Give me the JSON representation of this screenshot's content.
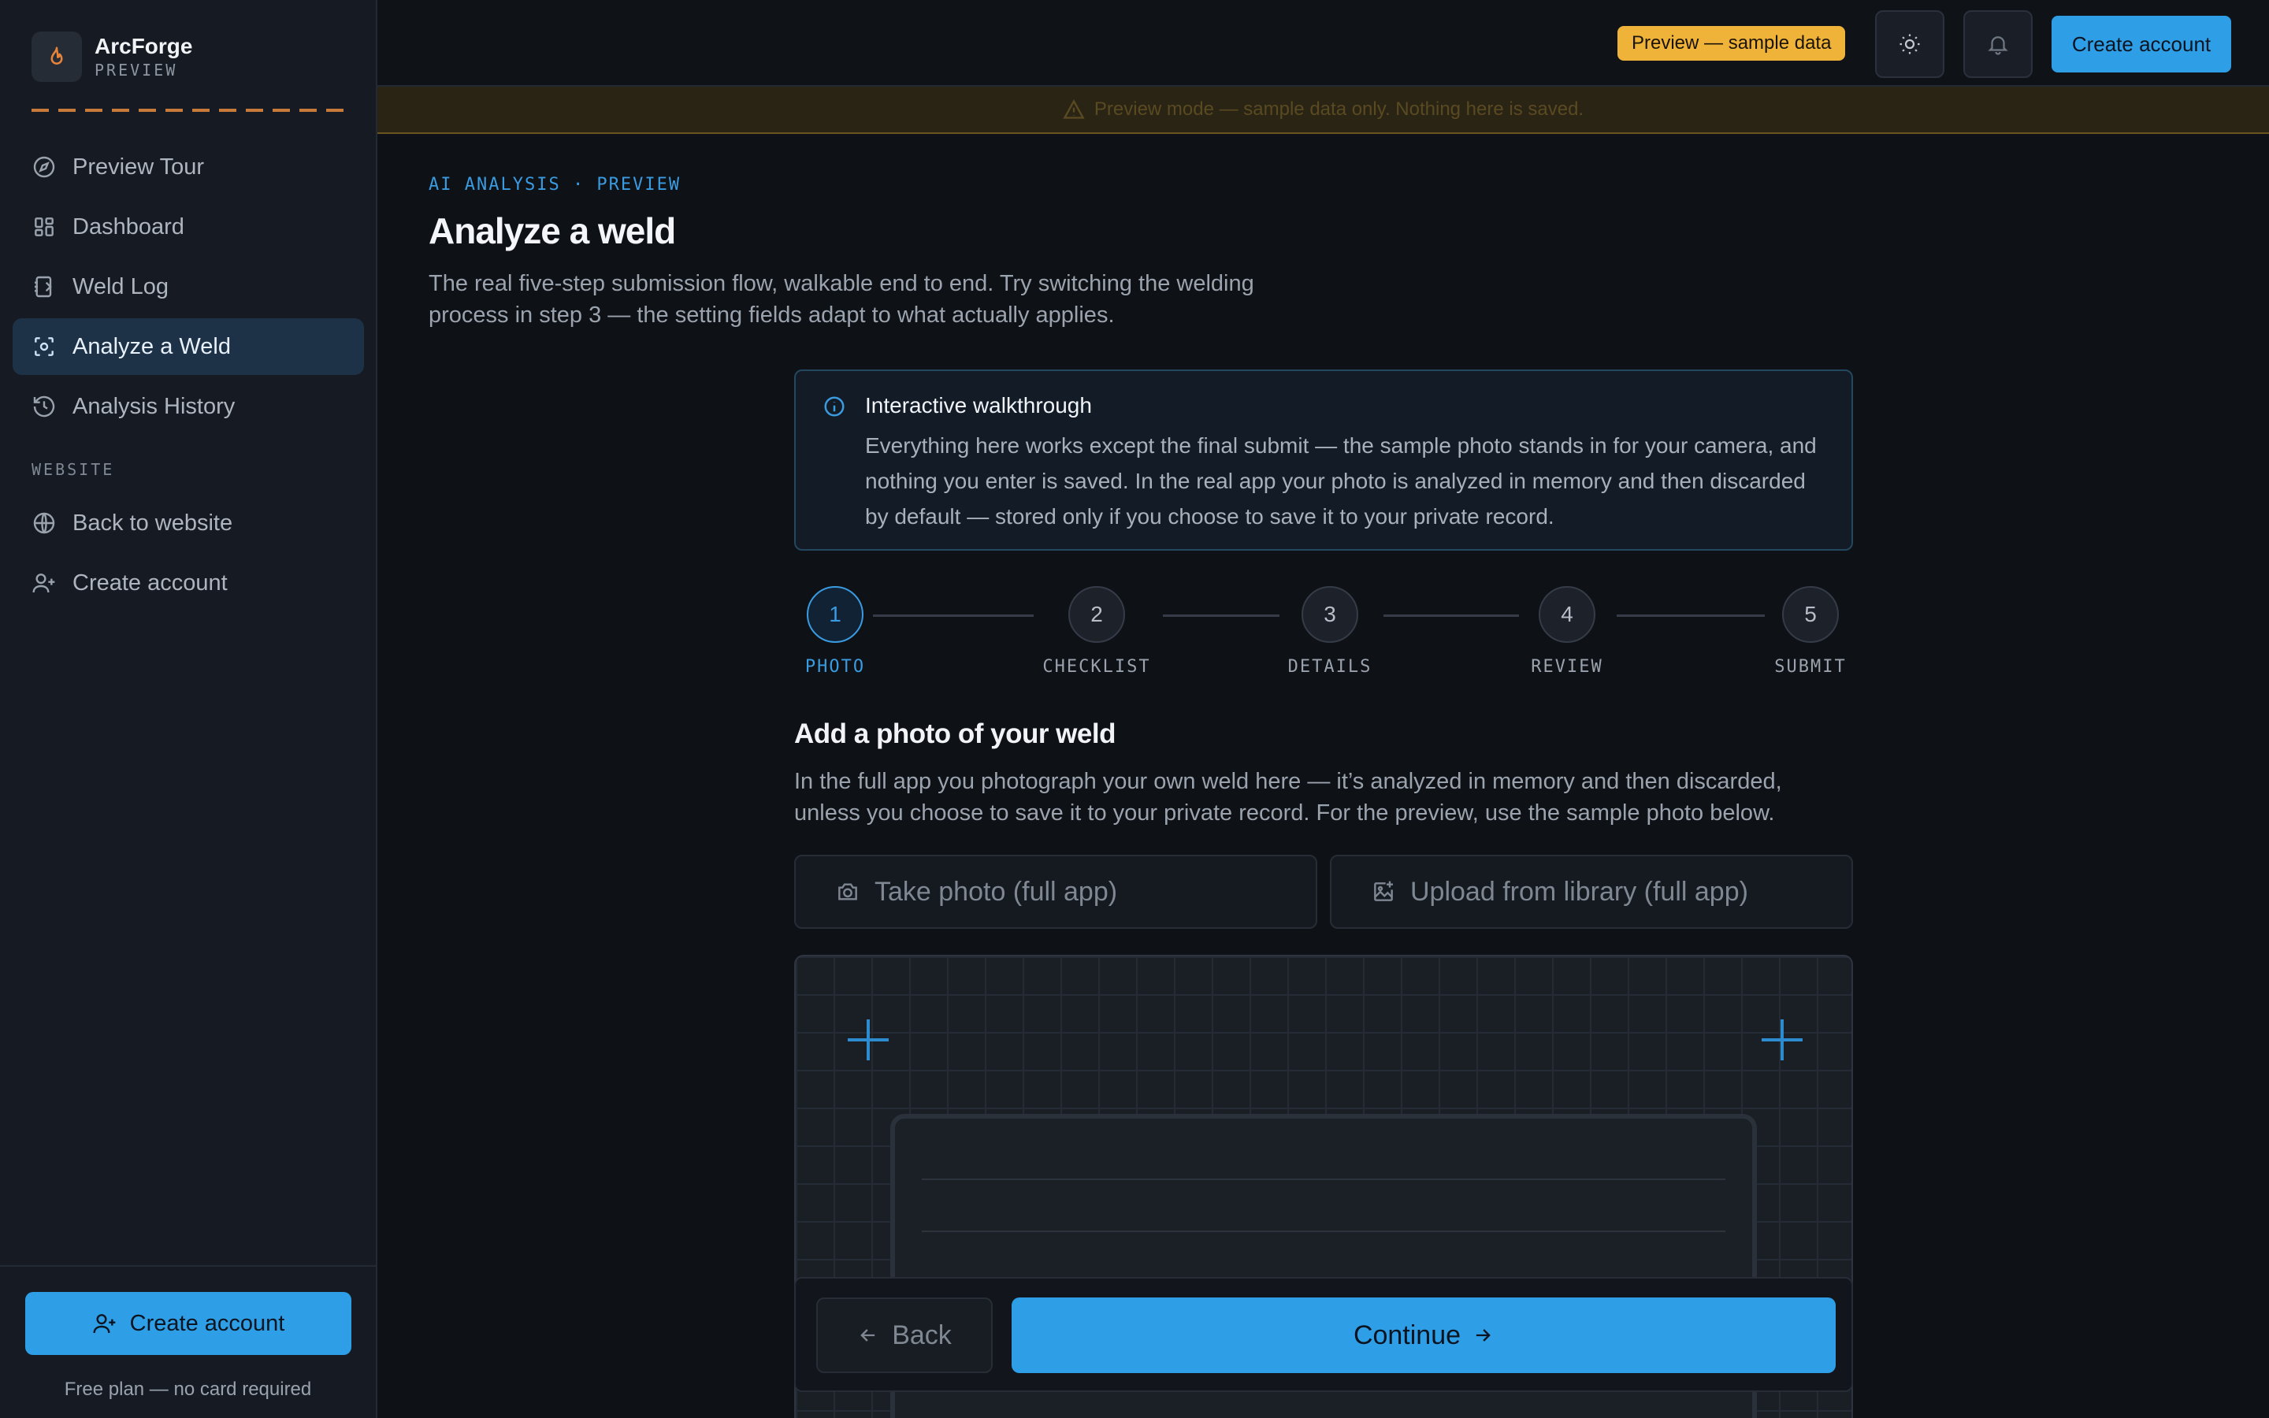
{
  "brand": {
    "name": "ArcForge",
    "sub": "PREVIEW"
  },
  "sidebar": {
    "items": [
      {
        "label": "Preview Tour",
        "icon": "compass-icon"
      },
      {
        "label": "Dashboard",
        "icon": "grid-icon"
      },
      {
        "label": "Weld Log",
        "icon": "notebook-icon"
      },
      {
        "label": "Analyze a Weld",
        "icon": "scan-icon",
        "active": true
      },
      {
        "label": "Analysis History",
        "icon": "history-icon"
      }
    ],
    "section_label": "WEBSITE",
    "website_items": [
      {
        "label": "Back to website",
        "icon": "globe-icon"
      },
      {
        "label": "Create account",
        "icon": "user-plus-icon"
      }
    ],
    "cta_label": "Create account",
    "cta_note": "Free plan — no card required"
  },
  "topbar": {
    "pill": "Preview — sample data",
    "cta_label": "Create account"
  },
  "banner": {
    "text": "Preview mode — sample data only. Nothing here is saved."
  },
  "main": {
    "eyebrow": "AI ANALYSIS · PREVIEW",
    "title": "Analyze a weld",
    "lead": "The real five-step submission flow, walkable end to end. Try switching the welding process in step 3 — the setting fields adapt to what actually applies.",
    "info": {
      "title": "Interactive walkthrough",
      "body": "Everything here works except the final submit — the sample photo stands in for your camera, and nothing you enter is saved. In the real app your photo is analyzed in memory and then discarded by default — stored only if you choose to save it to your private record."
    },
    "steps": [
      {
        "num": "1",
        "label": "PHOTO"
      },
      {
        "num": "2",
        "label": "CHECKLIST"
      },
      {
        "num": "3",
        "label": "DETAILS"
      },
      {
        "num": "4",
        "label": "REVIEW"
      },
      {
        "num": "5",
        "label": "SUBMIT"
      }
    ],
    "current_step": 1,
    "section_title": "Add a photo of your weld",
    "section_text": "In the full app you photograph your own weld here — it’s analyzed in memory and then discarded, unless you choose to save it to your private record. For the preview, use the sample photo below.",
    "take_photo": "Take photo (full app)",
    "upload": "Upload from library (full app)",
    "back": "Back",
    "continue": "Continue"
  },
  "colors": {
    "accent": "#2e9fe6",
    "warning": "#f0b33a",
    "brand_flame": "#e8843a"
  }
}
